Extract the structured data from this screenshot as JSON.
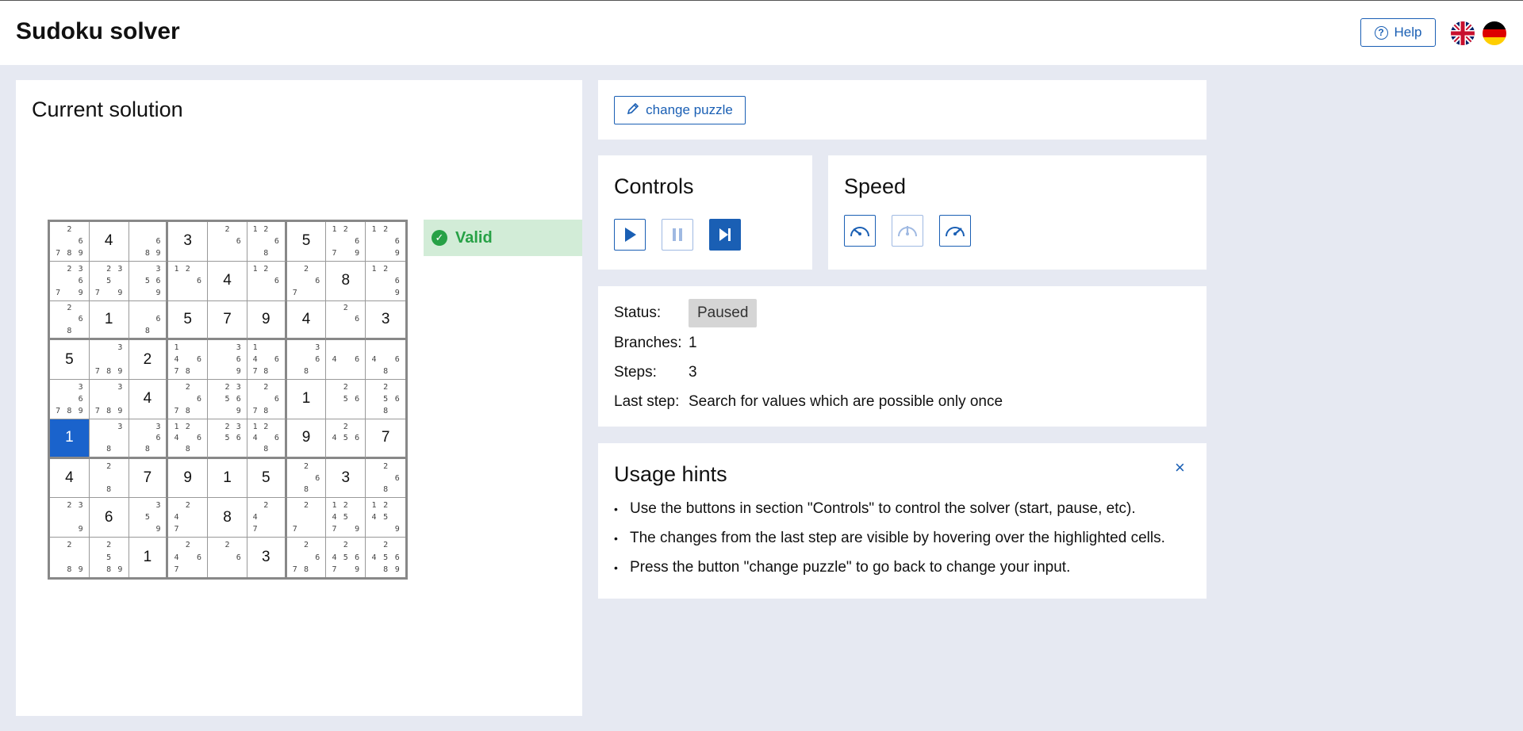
{
  "header": {
    "title": "Sudoku solver",
    "help_label": "Help",
    "languages": [
      "English",
      "Deutsch"
    ]
  },
  "solution": {
    "title": "Current solution",
    "validity": "Valid",
    "selected_cell": 45,
    "grid": [
      {
        "v": "",
        "c": [
          "",
          "2",
          "",
          "",
          "",
          "6",
          "7",
          "8",
          "9"
        ]
      },
      {
        "v": "4",
        "c": []
      },
      {
        "v": "",
        "c": [
          "",
          "",
          "",
          "",
          "",
          "6",
          "",
          "8",
          "9"
        ]
      },
      {
        "v": "3",
        "c": []
      },
      {
        "v": "",
        "c": [
          "",
          "2",
          "",
          "",
          "",
          "6",
          "",
          "",
          ""
        ]
      },
      {
        "v": "",
        "c": [
          "1",
          "2",
          "",
          "",
          "",
          "6",
          "",
          "8",
          ""
        ]
      },
      {
        "v": "5",
        "c": []
      },
      {
        "v": "",
        "c": [
          "1",
          "2",
          "",
          "",
          "",
          "6",
          "7",
          "",
          "9"
        ]
      },
      {
        "v": "",
        "c": [
          "1",
          "2",
          "",
          "",
          "",
          "6",
          "",
          "",
          "9"
        ]
      },
      {
        "v": "",
        "c": [
          "",
          "2",
          "3",
          "",
          "",
          "6",
          "7",
          "",
          "9"
        ]
      },
      {
        "v": "",
        "c": [
          "",
          "2",
          "3",
          "",
          "5",
          "",
          "7",
          "",
          "9"
        ]
      },
      {
        "v": "",
        "c": [
          "",
          "",
          "3",
          "",
          "5",
          "6",
          "",
          "",
          "9"
        ]
      },
      {
        "v": "",
        "c": [
          "1",
          "2",
          "",
          "",
          "",
          "6",
          "",
          "",
          ""
        ]
      },
      {
        "v": "4",
        "c": []
      },
      {
        "v": "",
        "c": [
          "1",
          "2",
          "",
          "",
          "",
          "6",
          "",
          "",
          ""
        ]
      },
      {
        "v": "",
        "c": [
          "",
          "2",
          "",
          "",
          "",
          "6",
          "7",
          "",
          ""
        ]
      },
      {
        "v": "8",
        "c": []
      },
      {
        "v": "",
        "c": [
          "1",
          "2",
          "",
          "",
          "",
          "6",
          "",
          "",
          "9"
        ]
      },
      {
        "v": "",
        "c": [
          "",
          "2",
          "",
          "",
          "",
          "6",
          "",
          "8",
          ""
        ]
      },
      {
        "v": "1",
        "c": []
      },
      {
        "v": "",
        "c": [
          "",
          "",
          "",
          "",
          "",
          "6",
          "",
          "8",
          ""
        ]
      },
      {
        "v": "5",
        "c": []
      },
      {
        "v": "7",
        "c": []
      },
      {
        "v": "9",
        "c": []
      },
      {
        "v": "4",
        "c": []
      },
      {
        "v": "",
        "c": [
          "",
          "2",
          "",
          "",
          "",
          "6",
          "",
          "",
          ""
        ]
      },
      {
        "v": "3",
        "c": []
      },
      {
        "v": "5",
        "c": []
      },
      {
        "v": "",
        "c": [
          "",
          "",
          "3",
          "",
          "",
          "",
          "7",
          "8",
          "9"
        ]
      },
      {
        "v": "2",
        "c": []
      },
      {
        "v": "",
        "c": [
          "1",
          "",
          "",
          "4",
          "",
          "6",
          "7",
          "8",
          ""
        ]
      },
      {
        "v": "",
        "c": [
          "",
          "",
          "3",
          "",
          "",
          "6",
          "",
          "",
          "9"
        ]
      },
      {
        "v": "",
        "c": [
          "1",
          "",
          "",
          "4",
          "",
          "6",
          "7",
          "8",
          ""
        ]
      },
      {
        "v": "",
        "c": [
          "",
          "",
          "3",
          "",
          "",
          "6",
          "",
          "8",
          ""
        ]
      },
      {
        "v": "",
        "c": [
          "",
          "",
          "",
          "4",
          "",
          "6",
          "",
          "",
          ""
        ]
      },
      {
        "v": "",
        "c": [
          "",
          "",
          "",
          "4",
          "",
          "6",
          "",
          "8",
          ""
        ]
      },
      {
        "v": "",
        "c": [
          "",
          "",
          "3",
          "",
          "",
          "6",
          "7",
          "8",
          "9"
        ]
      },
      {
        "v": "",
        "c": [
          "",
          "",
          "3",
          "",
          "",
          "",
          "7",
          "8",
          "9"
        ]
      },
      {
        "v": "4",
        "c": []
      },
      {
        "v": "",
        "c": [
          "",
          "2",
          "",
          "",
          "",
          "6",
          "7",
          "8",
          ""
        ]
      },
      {
        "v": "",
        "c": [
          "",
          "2",
          "3",
          "",
          "5",
          "6",
          "",
          "",
          "9"
        ]
      },
      {
        "v": "",
        "c": [
          "",
          "2",
          "",
          "",
          "",
          "6",
          "7",
          "8",
          ""
        ]
      },
      {
        "v": "1",
        "c": []
      },
      {
        "v": "",
        "c": [
          "",
          "2",
          "",
          "",
          "5",
          "6",
          "",
          "",
          ""
        ]
      },
      {
        "v": "",
        "c": [
          "",
          "2",
          "",
          "",
          "5",
          "6",
          "",
          "8",
          ""
        ]
      },
      {
        "v": "1",
        "c": []
      },
      {
        "v": "",
        "c": [
          "",
          "",
          "3",
          "",
          "",
          "",
          "",
          "8",
          ""
        ]
      },
      {
        "v": "",
        "c": [
          "",
          "",
          "3",
          "",
          "",
          "6",
          "",
          "8",
          ""
        ]
      },
      {
        "v": "",
        "c": [
          "1",
          "2",
          "",
          "4",
          "",
          "6",
          "",
          "8",
          ""
        ]
      },
      {
        "v": "",
        "c": [
          "",
          "2",
          "3",
          "",
          "5",
          "6",
          "",
          "",
          ""
        ]
      },
      {
        "v": "",
        "c": [
          "1",
          "2",
          "",
          "4",
          "",
          "6",
          "",
          "8",
          ""
        ]
      },
      {
        "v": "9",
        "c": []
      },
      {
        "v": "",
        "c": [
          "",
          "2",
          "",
          "4",
          "5",
          "6",
          "",
          "",
          ""
        ]
      },
      {
        "v": "7",
        "c": []
      },
      {
        "v": "4",
        "c": []
      },
      {
        "v": "",
        "c": [
          "",
          "2",
          "",
          "",
          "",
          "",
          "",
          "8",
          ""
        ]
      },
      {
        "v": "7",
        "c": []
      },
      {
        "v": "9",
        "c": []
      },
      {
        "v": "1",
        "c": []
      },
      {
        "v": "5",
        "c": []
      },
      {
        "v": "",
        "c": [
          "",
          "2",
          "",
          "",
          "",
          "6",
          "",
          "8",
          ""
        ]
      },
      {
        "v": "3",
        "c": []
      },
      {
        "v": "",
        "c": [
          "",
          "2",
          "",
          "",
          "",
          "6",
          "",
          "8",
          ""
        ]
      },
      {
        "v": "",
        "c": [
          "",
          "2",
          "3",
          "",
          "",
          "",
          "",
          "",
          "9"
        ]
      },
      {
        "v": "6",
        "c": []
      },
      {
        "v": "",
        "c": [
          "",
          "",
          "3",
          "",
          "5",
          "",
          "",
          "",
          "9"
        ]
      },
      {
        "v": "",
        "c": [
          "",
          "2",
          "",
          "4",
          "",
          "",
          "7",
          "",
          ""
        ]
      },
      {
        "v": "8",
        "c": []
      },
      {
        "v": "",
        "c": [
          "",
          "2",
          "",
          "4",
          "",
          "",
          "7",
          "",
          ""
        ]
      },
      {
        "v": "",
        "c": [
          "",
          "2",
          "",
          "",
          "",
          "",
          "7",
          "",
          ""
        ]
      },
      {
        "v": "",
        "c": [
          "1",
          "2",
          "",
          "4",
          "5",
          "",
          "7",
          "",
          "9"
        ]
      },
      {
        "v": "",
        "c": [
          "1",
          "2",
          "",
          "4",
          "5",
          "",
          "",
          "",
          "9"
        ]
      },
      {
        "v": "",
        "c": [
          "",
          "2",
          "",
          "",
          "",
          "",
          "",
          "8",
          "9"
        ]
      },
      {
        "v": "",
        "c": [
          "",
          "2",
          "",
          "",
          "5",
          "",
          "",
          "8",
          "9"
        ]
      },
      {
        "v": "1",
        "c": []
      },
      {
        "v": "",
        "c": [
          "",
          "2",
          "",
          "4",
          "",
          "6",
          "7",
          "",
          ""
        ]
      },
      {
        "v": "",
        "c": [
          "",
          "2",
          "",
          "",
          "",
          "6",
          "",
          "",
          ""
        ]
      },
      {
        "v": "3",
        "c": []
      },
      {
        "v": "",
        "c": [
          "",
          "2",
          "",
          "",
          "",
          "6",
          "7",
          "8",
          ""
        ]
      },
      {
        "v": "",
        "c": [
          "",
          "2",
          "",
          "4",
          "5",
          "6",
          "7",
          "",
          "9"
        ]
      },
      {
        "v": "",
        "c": [
          "",
          "2",
          "",
          "4",
          "5",
          "6",
          "",
          "8",
          "9"
        ]
      }
    ]
  },
  "change_puzzle_label": "change puzzle",
  "controls": {
    "title": "Controls",
    "buttons": [
      {
        "icon": "play-icon",
        "state": "enabled"
      },
      {
        "icon": "pause-icon",
        "state": "disabled"
      },
      {
        "icon": "step-forward-icon",
        "state": "active"
      }
    ]
  },
  "speed": {
    "title": "Speed",
    "buttons": [
      {
        "icon": "speed-slow-icon",
        "state": "enabled"
      },
      {
        "icon": "speed-medium-icon",
        "state": "disabled"
      },
      {
        "icon": "speed-fast-icon",
        "state": "enabled"
      }
    ]
  },
  "status": {
    "status_label": "Status:",
    "status_value": "Paused",
    "branches_label": "Branches:",
    "branches_value": "1",
    "steps_label": "Steps:",
    "steps_value": "3",
    "last_step_label": "Last step:",
    "last_step_value": "Search for values which are possible only once"
  },
  "hints": {
    "title": "Usage hints",
    "close_symbol": "×",
    "items": [
      "Use the buttons in section \"Controls\" to control the solver (start, pause, etc).",
      "The changes from the last step are visible by hovering over the highlighted cells.",
      "Press the button \"change puzzle\" to go back to change your input."
    ]
  },
  "colors": {
    "accent": "#1a5fb4",
    "valid_bg": "#d2ecd7",
    "valid_fg": "#27a146",
    "page_bg": "#e6e9f2",
    "selected_cell": "#1a63cc"
  }
}
